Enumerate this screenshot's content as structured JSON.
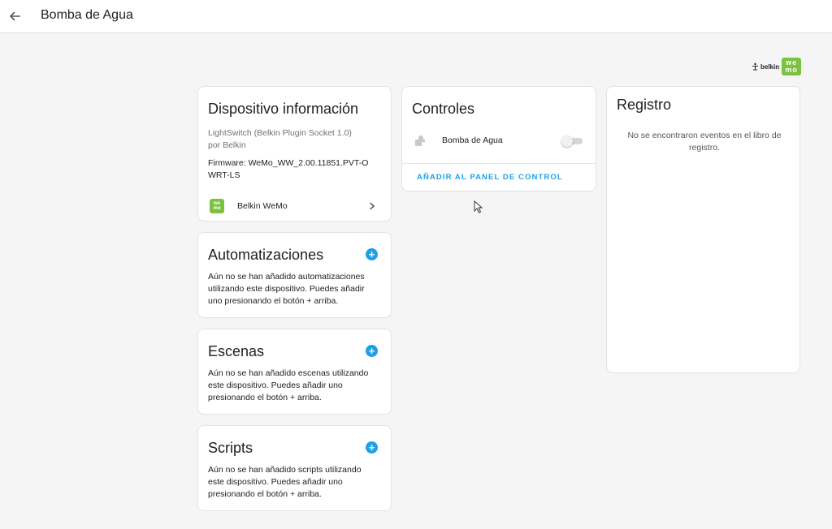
{
  "header": {
    "title": "Bomba de Agua",
    "back_icon": "arrow-left-icon"
  },
  "brand": {
    "belkin": "belkin",
    "wemo_top": "we",
    "wemo_bottom": "mo"
  },
  "device_info": {
    "title": "Dispositivo información",
    "model": "LightSwitch (Belkin Plugin Socket 1.0)",
    "manufacturer": "por Belkin",
    "firmware": "Firmware: WeMo_WW_2.00.11851.PVT-OWRT-LS",
    "integration_label": "Belkin WeMo",
    "integration_icon_top": "we",
    "integration_icon_bottom": "mo"
  },
  "automations": {
    "title": "Automatizaciones",
    "text": "Aún no se han añadido automatizaciones utilizando este dispositivo. Puedes añadir uno presionando el botón + arriba."
  },
  "scenes": {
    "title": "Escenas",
    "text": "Aún no se han añadido escenas utilizando este dispositivo. Puedes añadir uno presionando el botón + arriba."
  },
  "scripts": {
    "title": "Scripts",
    "text": "Aún no se han añadido scripts utilizando este dispositivo. Puedes añadir uno presionando el botón + arriba."
  },
  "controls": {
    "title": "Controles",
    "entity_label": "Bomba de Agua",
    "entity_icon": "water-pump-icon",
    "toggle_state": "off",
    "add_to_dashboard": "AÑADIR AL PANEL DE CONTROL"
  },
  "logbook": {
    "title": "Registro",
    "empty_text": "No se encontraron eventos en el libro de registro."
  },
  "colors": {
    "accent": "#1fa0e6",
    "wemo_green": "#7cc142",
    "background": "#f5f5f5"
  }
}
